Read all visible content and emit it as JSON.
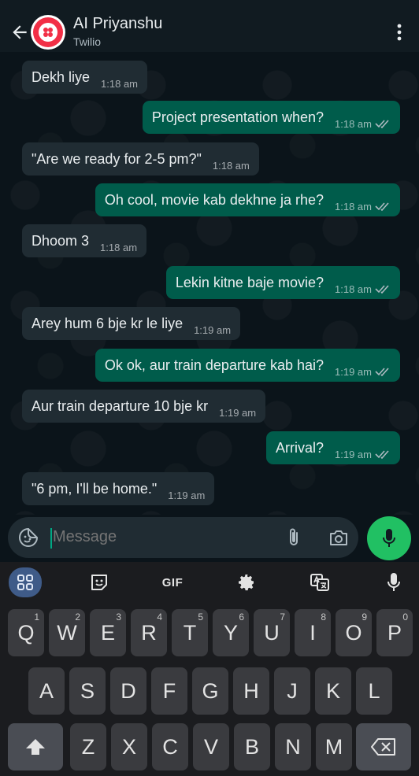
{
  "header": {
    "contact_name": "AI Priyanshu",
    "contact_subtitle": "Twilio"
  },
  "messages": [
    {
      "dir": "in",
      "text": "Dekh liye",
      "time": "1:18 am"
    },
    {
      "dir": "out",
      "text": "Project presentation when?",
      "time": "1:18 am"
    },
    {
      "dir": "in",
      "text": "\"Are we ready for 2-5 pm?\"",
      "time": "1:18 am"
    },
    {
      "dir": "out",
      "text": "Oh cool, movie kab dekhne ja rhe?",
      "time": "1:18 am"
    },
    {
      "dir": "in",
      "text": "Dhoom 3",
      "time": "1:18 am"
    },
    {
      "dir": "out",
      "text": "Lekin kitne baje movie?",
      "time": "1:18 am"
    },
    {
      "dir": "in",
      "text": "Arey hum 6 bje kr le liye",
      "time": "1:19 am"
    },
    {
      "dir": "out",
      "text": "Ok ok, aur train departure kab hai?",
      "time": "1:19 am"
    },
    {
      "dir": "in",
      "text": "Aur train departure 10 bje kr",
      "time": "1:19 am"
    },
    {
      "dir": "out",
      "text": "Arrival?",
      "time": "1:19 am"
    },
    {
      "dir": "in",
      "text": "\"6 pm, I'll be home.\"",
      "time": "1:19 am"
    }
  ],
  "composer": {
    "placeholder": "Message"
  },
  "keyboard": {
    "toolbar": {
      "gif_label": "GIF"
    },
    "row1": [
      {
        "key": "Q",
        "hint": "1"
      },
      {
        "key": "W",
        "hint": "2"
      },
      {
        "key": "E",
        "hint": "3"
      },
      {
        "key": "R",
        "hint": "4"
      },
      {
        "key": "T",
        "hint": "5"
      },
      {
        "key": "Y",
        "hint": "6"
      },
      {
        "key": "U",
        "hint": "7"
      },
      {
        "key": "I",
        "hint": "8"
      },
      {
        "key": "O",
        "hint": "9"
      },
      {
        "key": "P",
        "hint": "0"
      }
    ],
    "row2": [
      "A",
      "S",
      "D",
      "F",
      "G",
      "H",
      "J",
      "K",
      "L"
    ],
    "row3": [
      "Z",
      "X",
      "C",
      "V",
      "B",
      "N",
      "M"
    ]
  },
  "colors": {
    "incoming_bubble": "#202c33",
    "outgoing_bubble": "#005c4b",
    "accent_green": "#21c063",
    "background": "#0b141a"
  }
}
